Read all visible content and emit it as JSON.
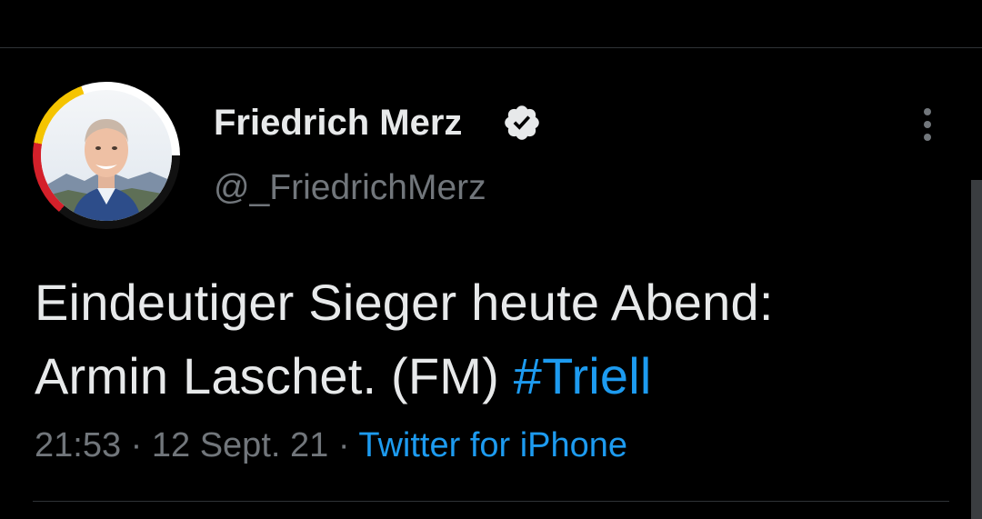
{
  "tweet": {
    "author_name": "Friedrich Merz",
    "author_handle": "@_FriedrichMerz",
    "text_line1": "Eindeutiger Sieger heute Abend:",
    "text_line2": "Armin Laschet. (FM) ",
    "hashtag": "#Triell",
    "time": "21:53",
    "separator": " · ",
    "date": "12 Sept. 21",
    "source": "Twitter for iPhone"
  },
  "icons": {
    "verified": "verified-badge-icon",
    "more": "more-vertical-icon"
  },
  "colors": {
    "background": "#000000",
    "text": "#e7e9ea",
    "muted": "#71767b",
    "link": "#1d9bf0",
    "divider": "#2f3336"
  }
}
